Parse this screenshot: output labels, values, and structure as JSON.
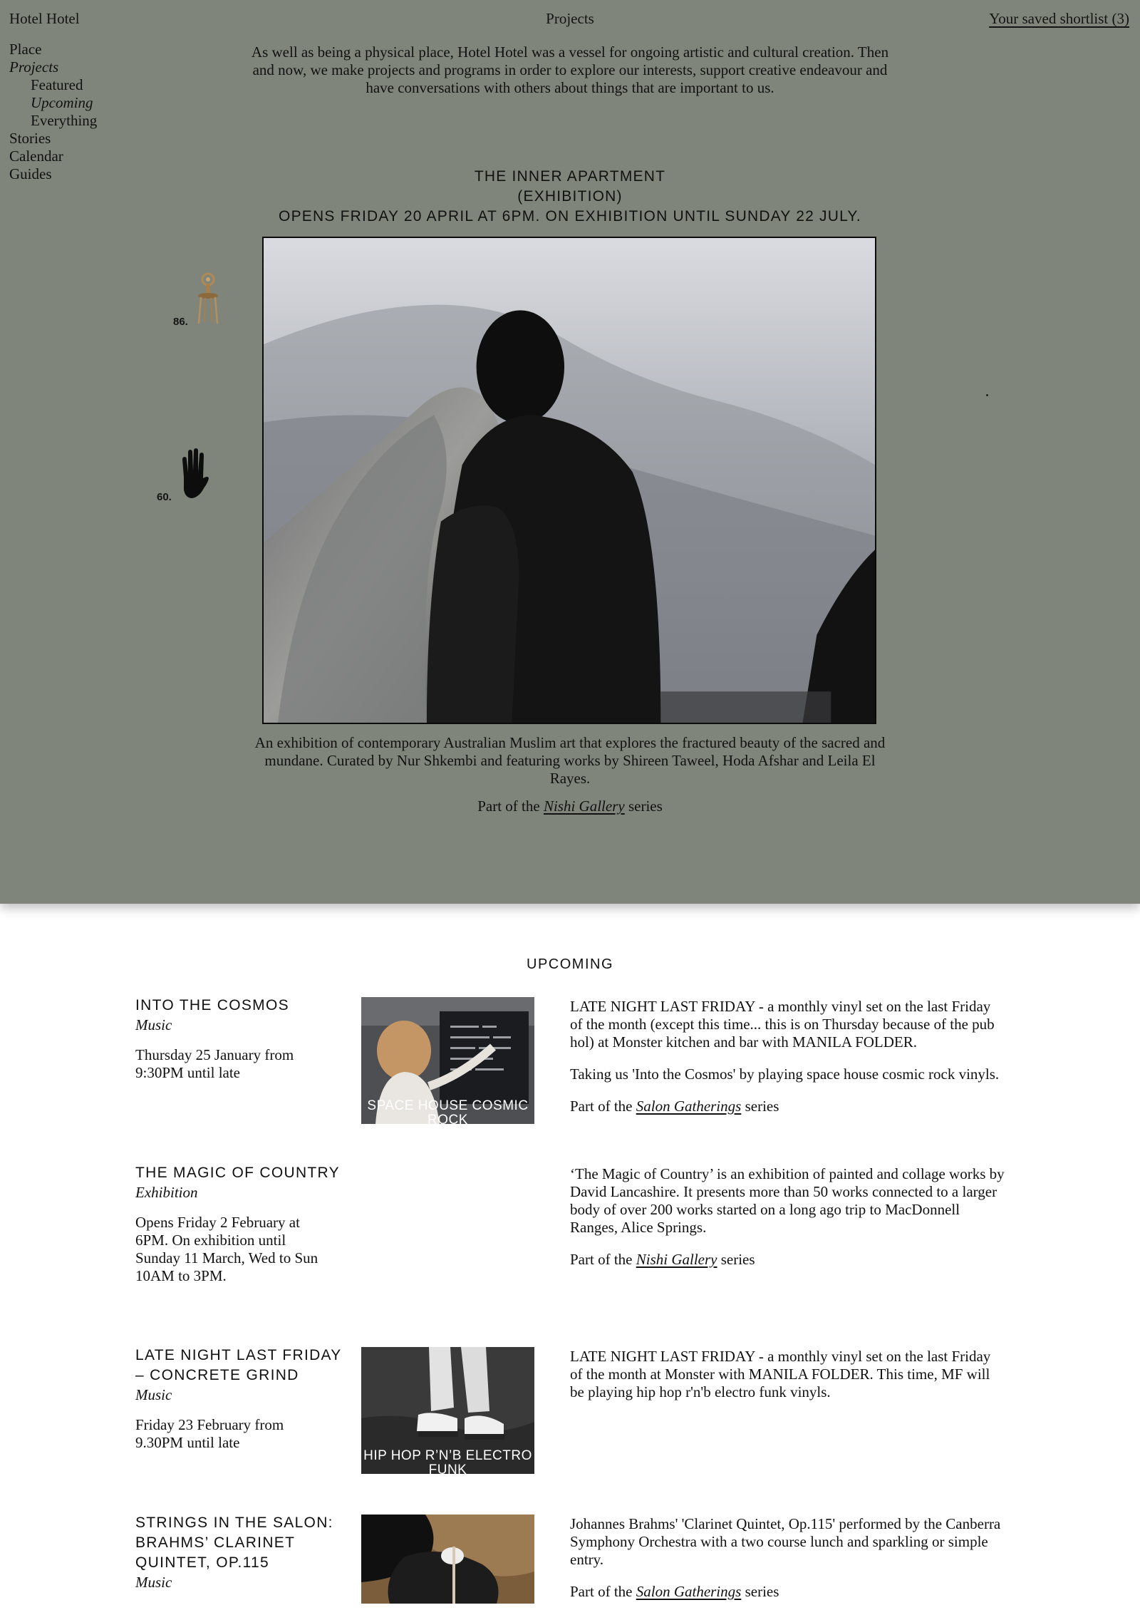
{
  "header": {
    "site_title": "Hotel Hotel",
    "section": "Projects",
    "shortlist": "Your saved shortlist (3)"
  },
  "sidenav": {
    "items": [
      "Place",
      "Projects",
      "Featured",
      "Upcoming",
      "Everything",
      "Stories",
      "Calendar",
      "Guides"
    ]
  },
  "intro": "As well as being a physical place, Hotel Hotel was a vessel for ongoing artistic and cultural creation. Then and now, we make projects and programs in order to explore our interests, support creative endeavour and have conversations with others about things that are important to us.",
  "featured": {
    "title": "The Inner Apartment",
    "category": "(Exhibition)",
    "dates": "Opens Friday 20 April at 6PM. On exhibition until Sunday 22 July.",
    "description": "An exhibition of contemporary Australian Muslim art that explores the fractured beauty of the sacred and mundane. Curated by Nur Shkembi and featuring works by Shireen Taweel, Hoda Afshar and Leila El Rayes.",
    "series_prefix": "Part of the",
    "series_name": "Nishi Gallery",
    "series_suffix": "series"
  },
  "shortlist_items": [
    {
      "number": "86.",
      "icon": "chair-icon"
    },
    {
      "number": "60.",
      "icon": "hand-icon"
    }
  ],
  "upcoming": {
    "heading": "UPCOMING",
    "events": [
      {
        "title": "Into the Cosmos",
        "category": "Music",
        "date": "Thursday 25 January from 9:30PM until late",
        "thumb_label": "SPACE HOUSE COSMIC ROCK",
        "paragraphs": [
          "LATE NIGHT LAST FRIDAY - a monthly vinyl set on the last Friday of the month (except this time... this is on Thursday because of the pub hol) at Monster kitchen and bar with MANILA FOLDER.",
          "Taking us 'Into the Cosmos' by playing space house cosmic rock vinyls."
        ],
        "series_prefix": "Part of the",
        "series_name": "Salon Gatherings",
        "series_suffix": "series"
      },
      {
        "title": "The Magic of Country",
        "category": "Exhibition",
        "date": "Opens Friday 2 February at 6PM. On exhibition until Sunday 11 March, Wed to Sun 10AM to 3PM.",
        "paragraphs": [
          "‘The Magic of Country’ is an exhibition of painted and collage works by David Lancashire. It presents more than 50 works connected to a larger body of over 200 works started on a long ago trip to MacDonnell Ranges, Alice Springs."
        ],
        "series_prefix": "Part of the",
        "series_name": "Nishi Gallery",
        "series_suffix": "series"
      },
      {
        "title": "Late Night Last Friday – Concrete Grind",
        "category": "Music",
        "date": "Friday 23 February from 9.30PM until late",
        "thumb_label": "HIP HOP R’N’B ELECTRO FUNK",
        "paragraphs": [
          "LATE NIGHT LAST FRIDAY - a monthly vinyl set on the last Friday of the month at Monster with MANILA FOLDER. This time, MF will be playing hip hop r'n'b electro funk vinyls."
        ]
      },
      {
        "title": "Strings in the Salon: Brahms’ Clarinet Quintet, Op.115",
        "category": "Music",
        "paragraphs": [
          "Johannes Brahms' 'Clarinet Quintet, Op.115' performed by the Canberra Symphony Orchestra with a two course lunch and sparkling or simple entry."
        ],
        "series_prefix": "Part of the",
        "series_name": "Salon Gatherings",
        "series_suffix": "series"
      }
    ]
  }
}
